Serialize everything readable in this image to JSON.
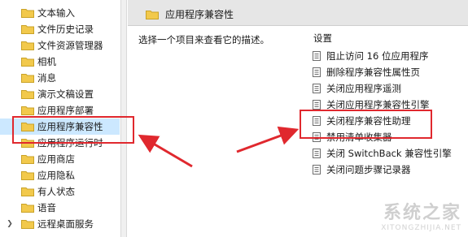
{
  "sidebar": {
    "items": [
      {
        "label": "文本输入",
        "expandable": false
      },
      {
        "label": "文件历史记录",
        "expandable": false
      },
      {
        "label": "文件资源管理器",
        "expandable": false
      },
      {
        "label": "相机",
        "expandable": false
      },
      {
        "label": "消息",
        "expandable": false
      },
      {
        "label": "演示文稿设置",
        "expandable": false
      },
      {
        "label": "应用程序部署",
        "expandable": false
      },
      {
        "label": "应用程序兼容性",
        "expandable": false,
        "selected": true
      },
      {
        "label": "应用程序运行时",
        "expandable": false
      },
      {
        "label": "应用商店",
        "expandable": false
      },
      {
        "label": "应用隐私",
        "expandable": false
      },
      {
        "label": "有人状态",
        "expandable": false
      },
      {
        "label": "语音",
        "expandable": false
      },
      {
        "label": "远程桌面服务",
        "expandable": true
      }
    ]
  },
  "header": {
    "title": "应用程序兼容性"
  },
  "description": "选择一个项目来查看它的描述。",
  "settings": {
    "heading": "设置",
    "items": [
      {
        "label": "阻止访问 16 位应用程序"
      },
      {
        "label": "删除程序兼容性属性页"
      },
      {
        "label": "关闭应用程序遥测"
      },
      {
        "label": "关闭应用程序兼容性引擎"
      },
      {
        "label": "关闭程序兼容性助理",
        "highlighted": true
      },
      {
        "label": "禁用清单收集器"
      },
      {
        "label": "关闭 SwitchBack 兼容性引擎"
      },
      {
        "label": "关闭问题步骤记录器"
      }
    ]
  },
  "watermark": {
    "main": "系统之家",
    "sub": "XITONGZHIJIA.NET"
  },
  "colors": {
    "folder": "#f2c94c",
    "highlight": "#e0282e",
    "header_bg": "#e6e6e6"
  },
  "icons": {
    "tree_item": "folder-icon",
    "setting_item": "policy-document-icon",
    "expander": "chevron-right-icon"
  }
}
